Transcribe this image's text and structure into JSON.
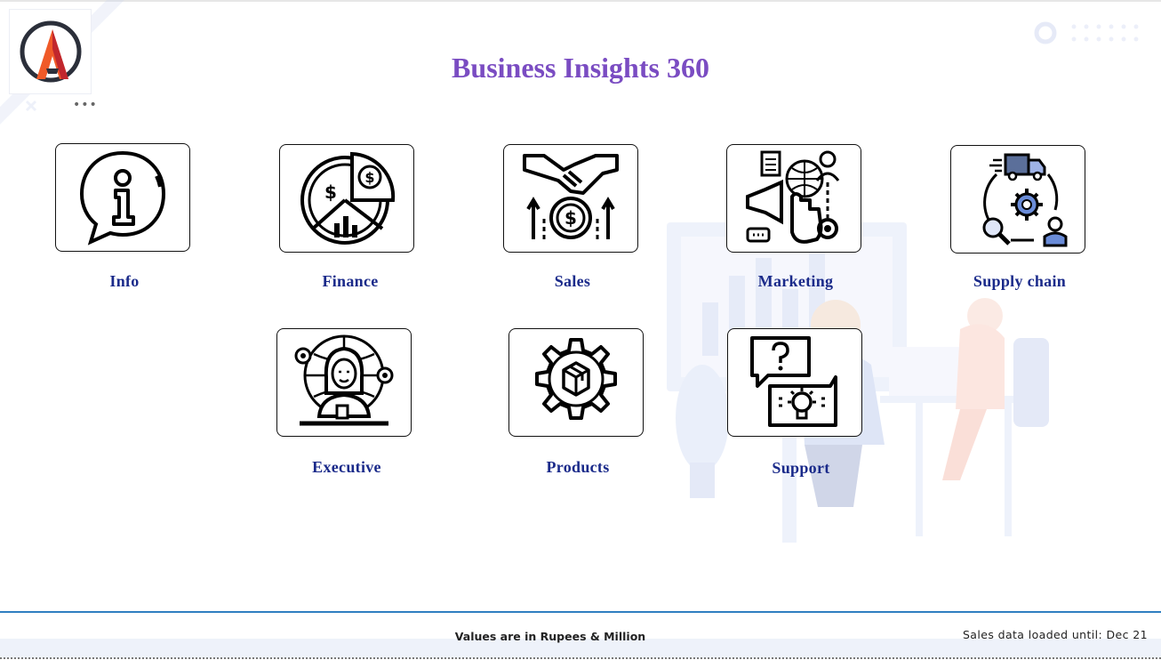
{
  "header": {
    "title": "Business Insights 360"
  },
  "logo": {
    "icon": "atliq-logo-icon",
    "menu_icon": "more-options-icon"
  },
  "tiles": [
    {
      "label": "Info",
      "icon": "info-speech-bubble-icon"
    },
    {
      "label": "Finance",
      "icon": "finance-pie-chart-icon"
    },
    {
      "label": "Sales",
      "icon": "sales-handshake-icon"
    },
    {
      "label": "Marketing",
      "icon": "marketing-megaphone-icon"
    },
    {
      "label": "Supply chain",
      "icon": "supply-chain-truck-icon"
    },
    {
      "label": "Executive",
      "icon": "executive-person-icon"
    },
    {
      "label": "Products",
      "icon": "products-gear-box-icon"
    },
    {
      "label": "Support",
      "icon": "support-question-bulb-icon"
    }
  ],
  "footer": {
    "note": "Values are in Rupees & Million",
    "status": "Sales data loaded until: Dec 21"
  },
  "colors": {
    "title": "#7a4cc2",
    "label": "#1a2a8a",
    "footer_line": "#2f7fc1",
    "logo_orange": "#f05a28",
    "logo_dark": "#2b2f3a",
    "icon_accent_blue": "#6a8cd8"
  }
}
